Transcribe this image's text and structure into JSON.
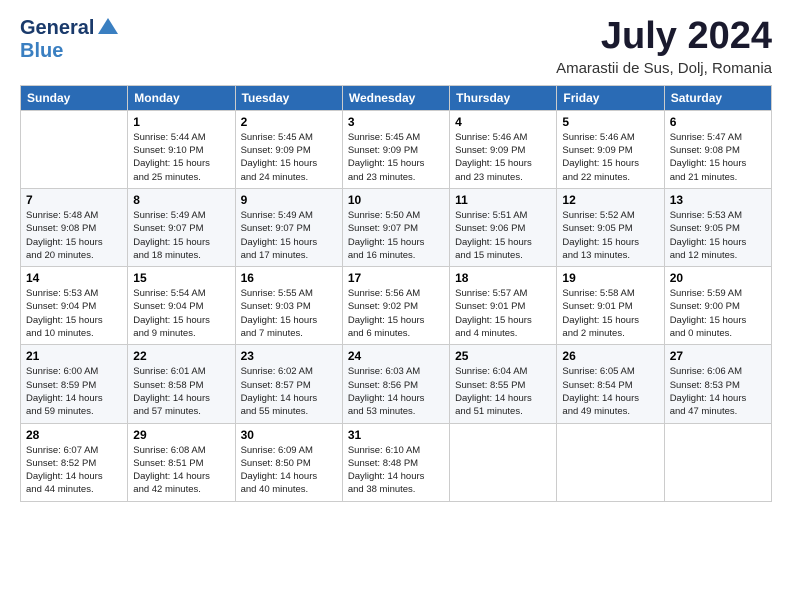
{
  "header": {
    "logo_general": "General",
    "logo_blue": "Blue",
    "title": "July 2024",
    "subtitle": "Amarastii de Sus, Dolj, Romania"
  },
  "days_of_week": [
    "Sunday",
    "Monday",
    "Tuesday",
    "Wednesday",
    "Thursday",
    "Friday",
    "Saturday"
  ],
  "weeks": [
    [
      {
        "day": "",
        "info": ""
      },
      {
        "day": "1",
        "info": "Sunrise: 5:44 AM\nSunset: 9:10 PM\nDaylight: 15 hours\nand 25 minutes."
      },
      {
        "day": "2",
        "info": "Sunrise: 5:45 AM\nSunset: 9:09 PM\nDaylight: 15 hours\nand 24 minutes."
      },
      {
        "day": "3",
        "info": "Sunrise: 5:45 AM\nSunset: 9:09 PM\nDaylight: 15 hours\nand 23 minutes."
      },
      {
        "day": "4",
        "info": "Sunrise: 5:46 AM\nSunset: 9:09 PM\nDaylight: 15 hours\nand 23 minutes."
      },
      {
        "day": "5",
        "info": "Sunrise: 5:46 AM\nSunset: 9:09 PM\nDaylight: 15 hours\nand 22 minutes."
      },
      {
        "day": "6",
        "info": "Sunrise: 5:47 AM\nSunset: 9:08 PM\nDaylight: 15 hours\nand 21 minutes."
      }
    ],
    [
      {
        "day": "7",
        "info": "Sunrise: 5:48 AM\nSunset: 9:08 PM\nDaylight: 15 hours\nand 20 minutes."
      },
      {
        "day": "8",
        "info": "Sunrise: 5:49 AM\nSunset: 9:07 PM\nDaylight: 15 hours\nand 18 minutes."
      },
      {
        "day": "9",
        "info": "Sunrise: 5:49 AM\nSunset: 9:07 PM\nDaylight: 15 hours\nand 17 minutes."
      },
      {
        "day": "10",
        "info": "Sunrise: 5:50 AM\nSunset: 9:07 PM\nDaylight: 15 hours\nand 16 minutes."
      },
      {
        "day": "11",
        "info": "Sunrise: 5:51 AM\nSunset: 9:06 PM\nDaylight: 15 hours\nand 15 minutes."
      },
      {
        "day": "12",
        "info": "Sunrise: 5:52 AM\nSunset: 9:05 PM\nDaylight: 15 hours\nand 13 minutes."
      },
      {
        "day": "13",
        "info": "Sunrise: 5:53 AM\nSunset: 9:05 PM\nDaylight: 15 hours\nand 12 minutes."
      }
    ],
    [
      {
        "day": "14",
        "info": "Sunrise: 5:53 AM\nSunset: 9:04 PM\nDaylight: 15 hours\nand 10 minutes."
      },
      {
        "day": "15",
        "info": "Sunrise: 5:54 AM\nSunset: 9:04 PM\nDaylight: 15 hours\nand 9 minutes."
      },
      {
        "day": "16",
        "info": "Sunrise: 5:55 AM\nSunset: 9:03 PM\nDaylight: 15 hours\nand 7 minutes."
      },
      {
        "day": "17",
        "info": "Sunrise: 5:56 AM\nSunset: 9:02 PM\nDaylight: 15 hours\nand 6 minutes."
      },
      {
        "day": "18",
        "info": "Sunrise: 5:57 AM\nSunset: 9:01 PM\nDaylight: 15 hours\nand 4 minutes."
      },
      {
        "day": "19",
        "info": "Sunrise: 5:58 AM\nSunset: 9:01 PM\nDaylight: 15 hours\nand 2 minutes."
      },
      {
        "day": "20",
        "info": "Sunrise: 5:59 AM\nSunset: 9:00 PM\nDaylight: 15 hours\nand 0 minutes."
      }
    ],
    [
      {
        "day": "21",
        "info": "Sunrise: 6:00 AM\nSunset: 8:59 PM\nDaylight: 14 hours\nand 59 minutes."
      },
      {
        "day": "22",
        "info": "Sunrise: 6:01 AM\nSunset: 8:58 PM\nDaylight: 14 hours\nand 57 minutes."
      },
      {
        "day": "23",
        "info": "Sunrise: 6:02 AM\nSunset: 8:57 PM\nDaylight: 14 hours\nand 55 minutes."
      },
      {
        "day": "24",
        "info": "Sunrise: 6:03 AM\nSunset: 8:56 PM\nDaylight: 14 hours\nand 53 minutes."
      },
      {
        "day": "25",
        "info": "Sunrise: 6:04 AM\nSunset: 8:55 PM\nDaylight: 14 hours\nand 51 minutes."
      },
      {
        "day": "26",
        "info": "Sunrise: 6:05 AM\nSunset: 8:54 PM\nDaylight: 14 hours\nand 49 minutes."
      },
      {
        "day": "27",
        "info": "Sunrise: 6:06 AM\nSunset: 8:53 PM\nDaylight: 14 hours\nand 47 minutes."
      }
    ],
    [
      {
        "day": "28",
        "info": "Sunrise: 6:07 AM\nSunset: 8:52 PM\nDaylight: 14 hours\nand 44 minutes."
      },
      {
        "day": "29",
        "info": "Sunrise: 6:08 AM\nSunset: 8:51 PM\nDaylight: 14 hours\nand 42 minutes."
      },
      {
        "day": "30",
        "info": "Sunrise: 6:09 AM\nSunset: 8:50 PM\nDaylight: 14 hours\nand 40 minutes."
      },
      {
        "day": "31",
        "info": "Sunrise: 6:10 AM\nSunset: 8:48 PM\nDaylight: 14 hours\nand 38 minutes."
      },
      {
        "day": "",
        "info": ""
      },
      {
        "day": "",
        "info": ""
      },
      {
        "day": "",
        "info": ""
      }
    ]
  ]
}
